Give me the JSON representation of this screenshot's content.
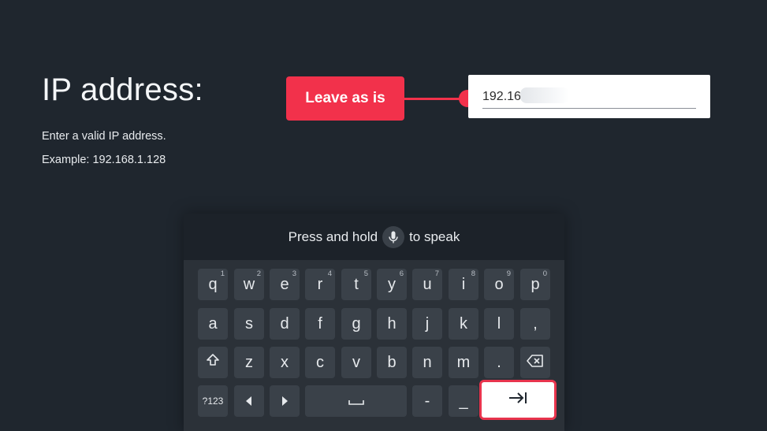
{
  "page": {
    "title": "IP address:",
    "instruction": "Enter a valid IP address.",
    "example": "Example: 192.168.1.128"
  },
  "callout": {
    "label": "Leave as is",
    "color": "#f2314b"
  },
  "ip_field": {
    "value": "192.16"
  },
  "keyboard": {
    "voice_prefix": "Press and hold",
    "voice_suffix": "to speak",
    "mic_icon": "microphone-icon",
    "rows": [
      [
        {
          "label": "q",
          "hint": "1"
        },
        {
          "label": "w",
          "hint": "2"
        },
        {
          "label": "e",
          "hint": "3"
        },
        {
          "label": "r",
          "hint": "4"
        },
        {
          "label": "t",
          "hint": "5"
        },
        {
          "label": "y",
          "hint": "6"
        },
        {
          "label": "u",
          "hint": "7"
        },
        {
          "label": "i",
          "hint": "8"
        },
        {
          "label": "o",
          "hint": "9"
        },
        {
          "label": "p",
          "hint": "0"
        }
      ],
      [
        {
          "label": "a"
        },
        {
          "label": "s"
        },
        {
          "label": "d"
        },
        {
          "label": "f"
        },
        {
          "label": "g"
        },
        {
          "label": "h"
        },
        {
          "label": "j"
        },
        {
          "label": "k"
        },
        {
          "label": "l"
        },
        {
          "label": ","
        }
      ],
      [
        {
          "label": "shift",
          "icon": "shift-icon"
        },
        {
          "label": "z"
        },
        {
          "label": "x"
        },
        {
          "label": "c"
        },
        {
          "label": "v"
        },
        {
          "label": "b"
        },
        {
          "label": "n"
        },
        {
          "label": "m"
        },
        {
          "label": "."
        },
        {
          "label": "backspace",
          "icon": "backspace-icon"
        }
      ]
    ],
    "bottom_row": {
      "symbols_label": "?123",
      "left_icon": "arrow-left-icon",
      "right_icon": "arrow-right-icon",
      "space_icon": "space-icon",
      "dash_label": "-",
      "underscore_label": "_",
      "next_icon": "tab-next-icon"
    }
  }
}
